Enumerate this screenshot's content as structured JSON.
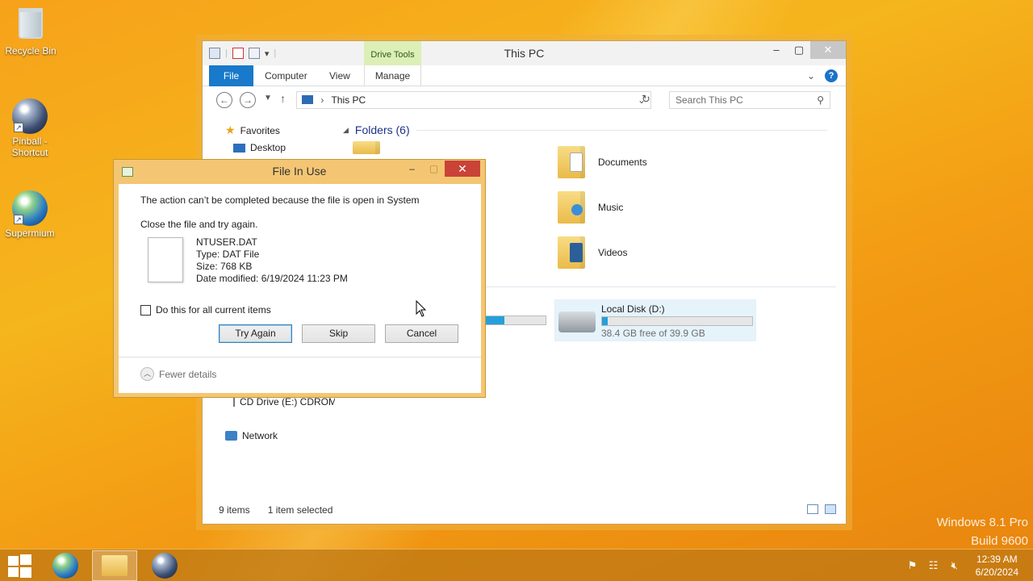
{
  "desktop": {
    "icons": [
      {
        "label": "Recycle Bin"
      },
      {
        "label": "Pinball - Shortcut"
      },
      {
        "label": "Supermium"
      }
    ],
    "watermark": {
      "line1": "Windows 8.1 Pro",
      "line2": "Build 9600"
    }
  },
  "explorer": {
    "title": "This PC",
    "context_tab": "Drive Tools",
    "ribbon_tabs": {
      "file": "File",
      "computer": "Computer",
      "view": "View",
      "manage": "Manage"
    },
    "address": "This PC",
    "search_placeholder": "Search This PC",
    "nav": {
      "favorites": "Favorites",
      "desktop": "Desktop",
      "cd_drive": "CD Drive (E:) CDROM",
      "network": "Network"
    },
    "folders_group": "Folders (6)",
    "folders": [
      {
        "label": "Documents"
      },
      {
        "label": "Music"
      },
      {
        "label": "Videos"
      }
    ],
    "drive": {
      "name": "Local Disk (D:)",
      "free_text": "38.4 GB free of 39.9 GB",
      "used_fraction": 0.04
    },
    "status": {
      "items": "9 items",
      "selected": "1 item selected"
    }
  },
  "dialog": {
    "title": "File In Use",
    "message": "The action can’t be completed because the file is open in System",
    "instruction": "Close the file and try again.",
    "file": {
      "name": "NTUSER.DAT",
      "type": "Type: DAT File",
      "size": "Size: 768 KB",
      "modified": "Date modified: 6/19/2024 11:23 PM"
    },
    "checkbox_label": "Do this for all current items",
    "buttons": {
      "try_again": "Try Again",
      "skip": "Skip",
      "cancel": "Cancel"
    },
    "fewer_details": "Fewer details"
  },
  "taskbar": {
    "time": "12:39 AM",
    "date": "6/20/2024"
  },
  "colors": {
    "accent": "#1979ca",
    "drive_bar": "#26a0da",
    "dialog_frame": "#f4c673",
    "close_red": "#c94337"
  }
}
